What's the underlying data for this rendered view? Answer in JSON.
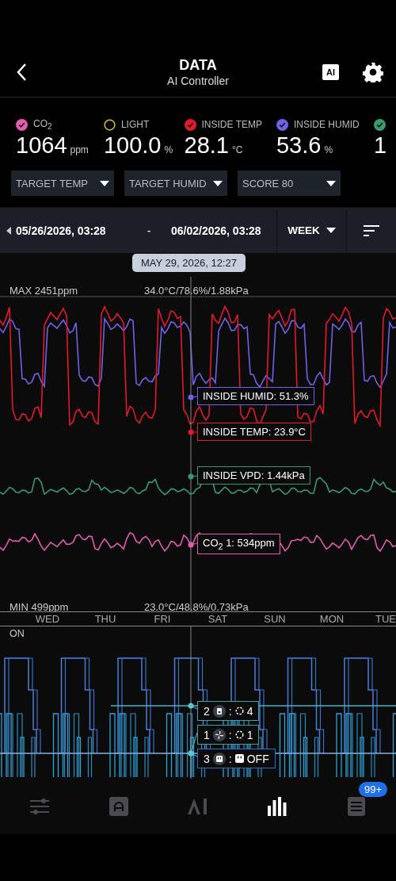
{
  "header": {
    "title": "DATA",
    "subtitle": "AI Controller",
    "ai_button": "AI"
  },
  "sensors": [
    {
      "label": "CO$_{2}$",
      "value": "1064",
      "unit": "ppm",
      "checked": true,
      "color": "#e45bb0"
    },
    {
      "label": "LIGHT",
      "value": "100.0",
      "unit": "%",
      "checked": false,
      "color": "#d8c531"
    },
    {
      "label": "INSIDE TEMP",
      "value": "28.1",
      "unit": "°C",
      "checked": true,
      "color": "#e3192d"
    },
    {
      "label": "INSIDE HUMID",
      "value": "53.6",
      "unit": "%",
      "checked": true,
      "color": "#6c63e8"
    },
    {
      "value": "1",
      "checked": true,
      "color": "#3a9a6e"
    }
  ],
  "filters": [
    {
      "label": "TARGET TEMP"
    },
    {
      "label": "TARGET HUMID"
    },
    {
      "label": "SCORE 80"
    }
  ],
  "range": {
    "start": "05/26/2026, 03:28",
    "separator": "-",
    "end": "06/02/2026, 03:28",
    "period": "WEEK"
  },
  "chart": {
    "cursor_time": "MAY 29, 2026, 12:27",
    "max_label": "MAX 2451ppm",
    "max_values": "34.0°C/78.6%/1.88kPa",
    "min_label": "MIN 499ppm",
    "min_values": "23.0°C/48.8%/0.73kPa",
    "readouts": [
      {
        "text": "INSIDE HUMID: 51.3%",
        "color": "#6c63e8"
      },
      {
        "text": "INSIDE TEMP: 23.9°C",
        "color": "#e3192d"
      },
      {
        "text": "INSIDE VPD: 1.44kPa",
        "color": "#3a9a6e"
      },
      {
        "text": "CO$_{2}$ 1: 534ppm",
        "color": "#e45bb0"
      }
    ]
  },
  "days": [
    "WED",
    "THU",
    "FRI",
    "SAT",
    "SUN",
    "MON",
    "TUE"
  ],
  "ports": {
    "state_label": "ON",
    "tags": [
      {
        "port": "2",
        "kind": "heater",
        "separator": ":",
        "value": "4"
      },
      {
        "port": "1",
        "kind": "fan",
        "separator": ":",
        "value": "1"
      },
      {
        "port": "3",
        "kind": "outlet",
        "separator": ":",
        "value": "OFF"
      }
    ]
  },
  "nav": [
    {
      "kind": "controls",
      "selected": false
    },
    {
      "kind": "automation",
      "selected": false
    },
    {
      "kind": "ai",
      "selected": false
    },
    {
      "kind": "data",
      "selected": true
    },
    {
      "kind": "log",
      "selected": false,
      "badge": "99+"
    }
  ]
}
